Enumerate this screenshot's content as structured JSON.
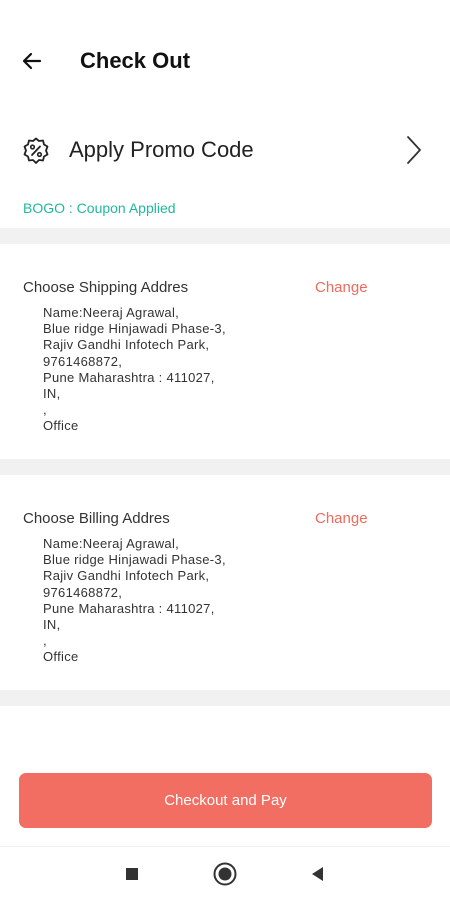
{
  "header": {
    "title": "Check Out",
    "back_icon": "arrow-left-icon"
  },
  "promo": {
    "label": "Apply Promo Code",
    "icon": "discount-badge-icon",
    "chevron_icon": "chevron-right-icon"
  },
  "coupon": {
    "status": "BOGO : Coupon Applied",
    "color": "#1fba9b"
  },
  "shipping": {
    "title": "Choose Shipping Addres",
    "change_label": "Change",
    "lines": [
      "Name:Neeraj Agrawal,",
      "Blue ridge Hinjawadi Phase-3,",
      "Rajiv Gandhi Infotech Park,",
      "9761468872,",
      "Pune Maharashtra : 411027,",
      "IN,",
      ",",
      "Office"
    ]
  },
  "billing": {
    "title": "Choose Billing Addres",
    "change_label": "Change",
    "lines": [
      "Name:Neeraj Agrawal,",
      "Blue ridge Hinjawadi Phase-3,",
      "Rajiv Gandhi Infotech Park,",
      "9761468872,",
      "Pune Maharashtra : 411027,",
      "IN,",
      ",",
      "Office"
    ]
  },
  "checkout": {
    "label": "Checkout and Pay",
    "color": "#f26e62"
  },
  "navbar": {
    "items": [
      "recents-square-icon",
      "home-circle-icon",
      "back-triangle-icon"
    ]
  }
}
